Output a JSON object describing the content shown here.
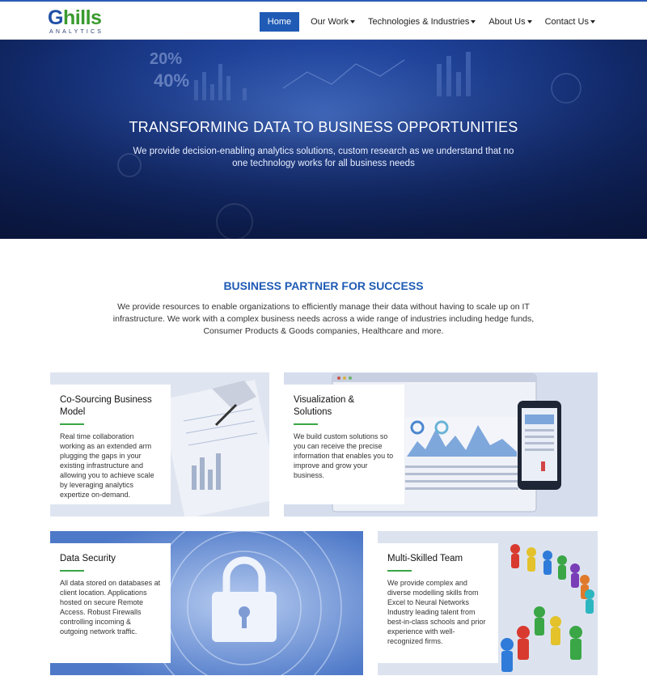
{
  "brand": {
    "logo_main": "Ghills",
    "logo_sub": "ANALYTICS"
  },
  "nav": {
    "items": [
      {
        "label": "Home",
        "active": true,
        "dropdown": false
      },
      {
        "label": "Our Work",
        "active": false,
        "dropdown": true
      },
      {
        "label": "Technologies & Industries",
        "active": false,
        "dropdown": true
      },
      {
        "label": "About Us",
        "active": false,
        "dropdown": true
      },
      {
        "label": "Contact Us",
        "active": false,
        "dropdown": true
      }
    ]
  },
  "hero": {
    "title": "TRANSFORMING DATA TO BUSINESS OPPORTUNITIES",
    "subtitle": "We provide decision-enabling analytics solutions, custom research as we understand that no one technology works for all business needs",
    "overlay_text": [
      "20%",
      "40%"
    ]
  },
  "partner": {
    "title": "BUSINESS PARTNER FOR SUCCESS",
    "text": "We provide resources to enable organizations to efficiently manage their data without having to scale up on IT infrastructure. We work with a complex business needs across a wide range of industries including hedge funds, Consumer Products & Goods companies, Healthcare and more."
  },
  "cards": [
    {
      "title": "Co-Sourcing Business Model",
      "text": "Real time collaboration working as an extended arm plugging the gaps in your existing infrastructure and allowing you to achieve scale by leveraging analytics expertize on-demand."
    },
    {
      "title": "Visualization & Solutions",
      "text": "We build custom solutions so you can receive the precise information that enables you to improve and grow your business."
    },
    {
      "title": "Data Security",
      "text": "All data stored on databases at client location. Applications hosted on secure Remote Access. Robust Firewalls controlling incoming & outgoing network traffic."
    },
    {
      "title": "Multi-Skilled Team",
      "text": "We provide complex and diverse modelling skills from Excel to Neural Networks Industry leading talent from best-in-class schools and prior experience with well-recognized firms."
    }
  ],
  "colors": {
    "accent": "#1f5bb5",
    "green": "#3aa646"
  }
}
